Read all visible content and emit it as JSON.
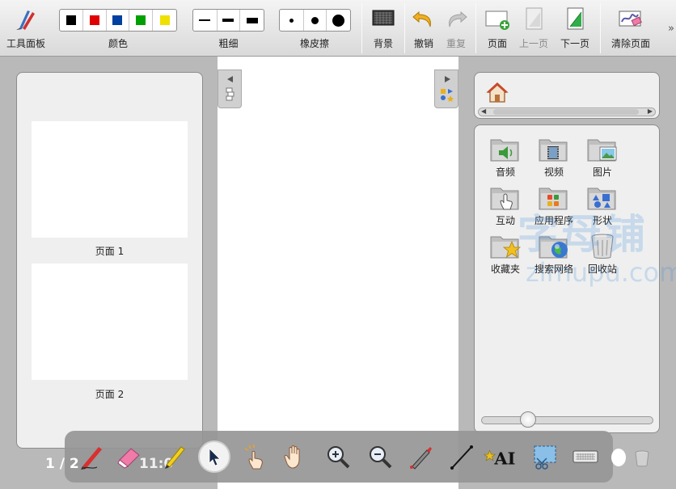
{
  "toolbar": {
    "toolpanel_label": "工具面板",
    "color_label": "颜色",
    "colors": [
      "#000000",
      "#e00000",
      "#0040a0",
      "#00a000",
      "#f0e000"
    ],
    "thickness_label": "粗细",
    "eraser_label": "橡皮擦",
    "background_label": "背景",
    "undo_label": "撤销",
    "redo_label": "重复",
    "page_label": "页面",
    "prev_page_label": "上一页",
    "next_page_label": "下一页",
    "clear_page_label": "清除页面",
    "more_label": "»"
  },
  "pages": {
    "items": [
      {
        "label": "页面 1"
      },
      {
        "label": "页面 2"
      }
    ]
  },
  "resources": {
    "folders": [
      {
        "label": "音频",
        "icon": "audio-folder-icon"
      },
      {
        "label": "视频",
        "icon": "video-folder-icon"
      },
      {
        "label": "图片",
        "icon": "image-folder-icon"
      },
      {
        "label": "互动",
        "icon": "interactive-folder-icon"
      },
      {
        "label": "应用程序",
        "icon": "applications-folder-icon"
      },
      {
        "label": "形状",
        "icon": "shapes-folder-icon"
      },
      {
        "label": "收藏夹",
        "icon": "favorites-folder-icon"
      },
      {
        "label": "搜索网络",
        "icon": "web-search-icon"
      },
      {
        "label": "回收站",
        "icon": "recycle-bin-icon"
      }
    ]
  },
  "bottom": {
    "page_counter": "1 / 2",
    "time": "11:0"
  },
  "watermark": {
    "line1": "字母铺",
    "line2": "zimupu.com"
  }
}
